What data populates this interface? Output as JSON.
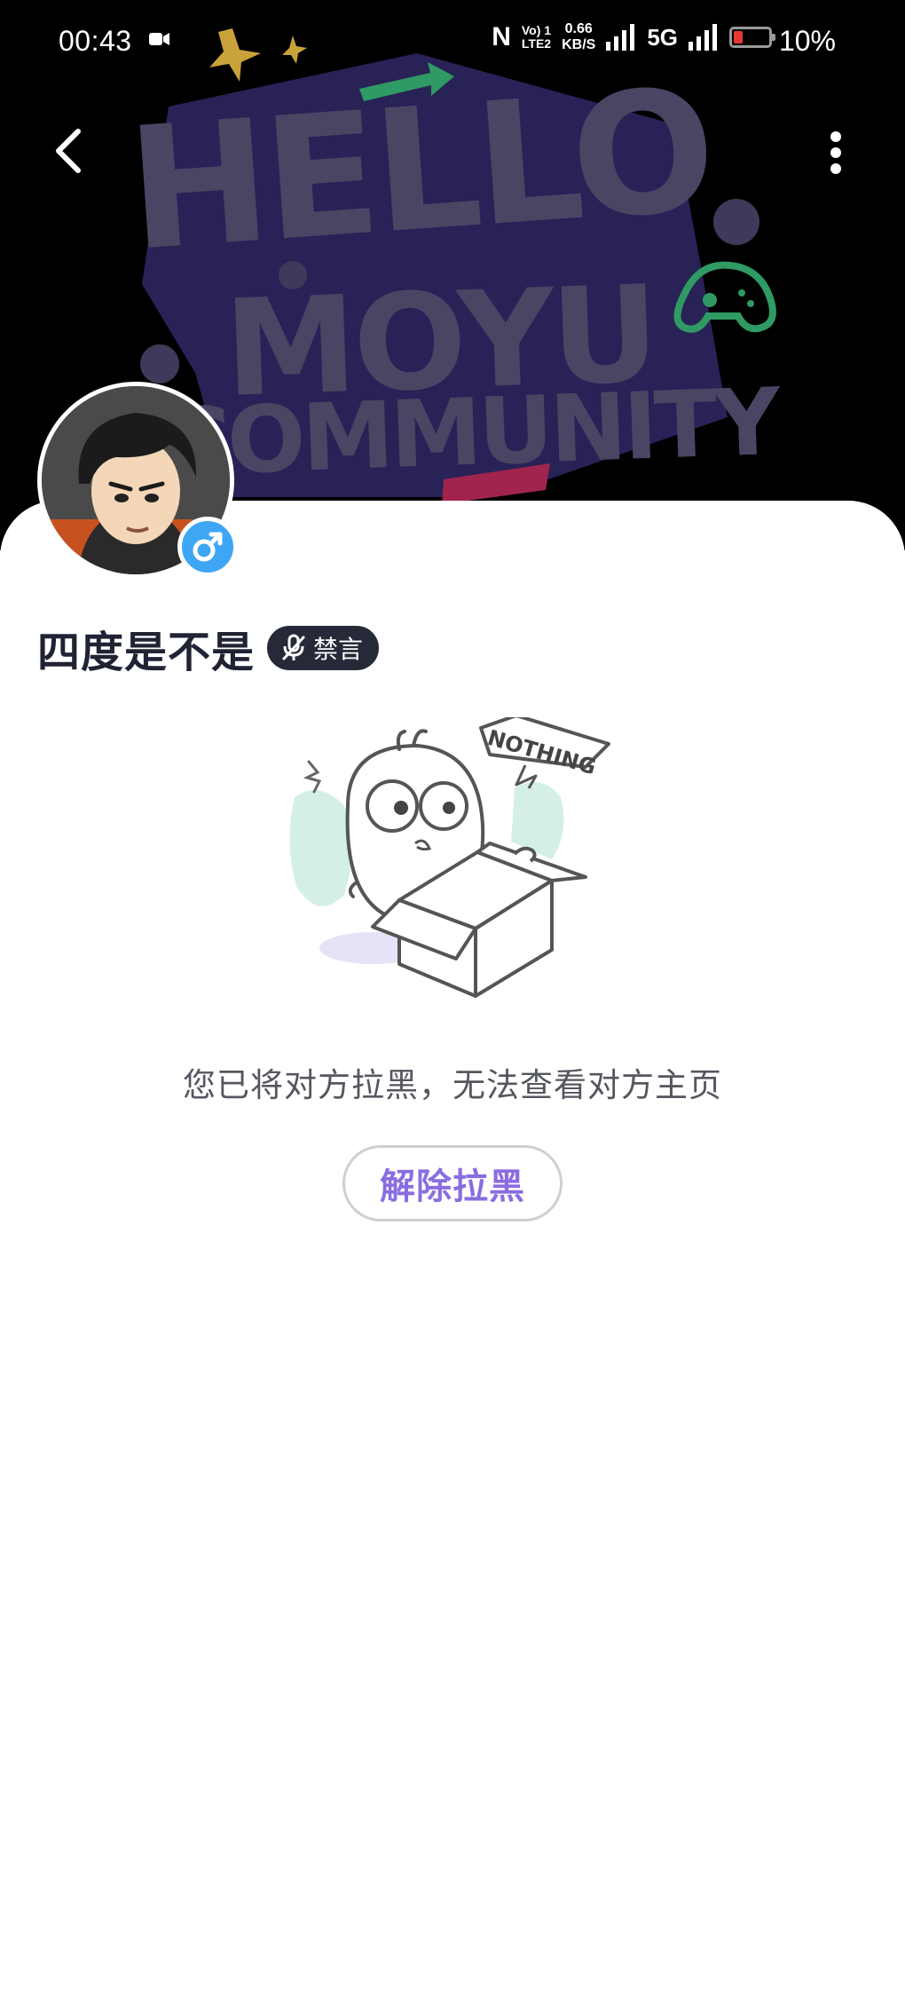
{
  "status_bar": {
    "time": "00:43",
    "nfc": "N",
    "volte_top": "Vo) 1",
    "volte_bottom": "LTE2",
    "speed_value": "0.66",
    "speed_unit": "KB/S",
    "network": "5G",
    "battery_percent": "10%",
    "battery_level": 0.1
  },
  "banner": {
    "line1": "HELLO",
    "line2": "MOYU",
    "line3": "COMMUNITY"
  },
  "profile": {
    "username": "四度是不是",
    "gender": "♂",
    "mute_label": "禁言",
    "empty_badge": "NOTHING"
  },
  "blocked": {
    "message": "您已将对方拉黑，无法查看对方主页",
    "unblock_label": "解除拉黑"
  },
  "colors": {
    "accent": "#8a6de0",
    "gender_badge": "#3fa6f5",
    "badge_bg": "#262a38",
    "banner_text": "#4a4563"
  }
}
